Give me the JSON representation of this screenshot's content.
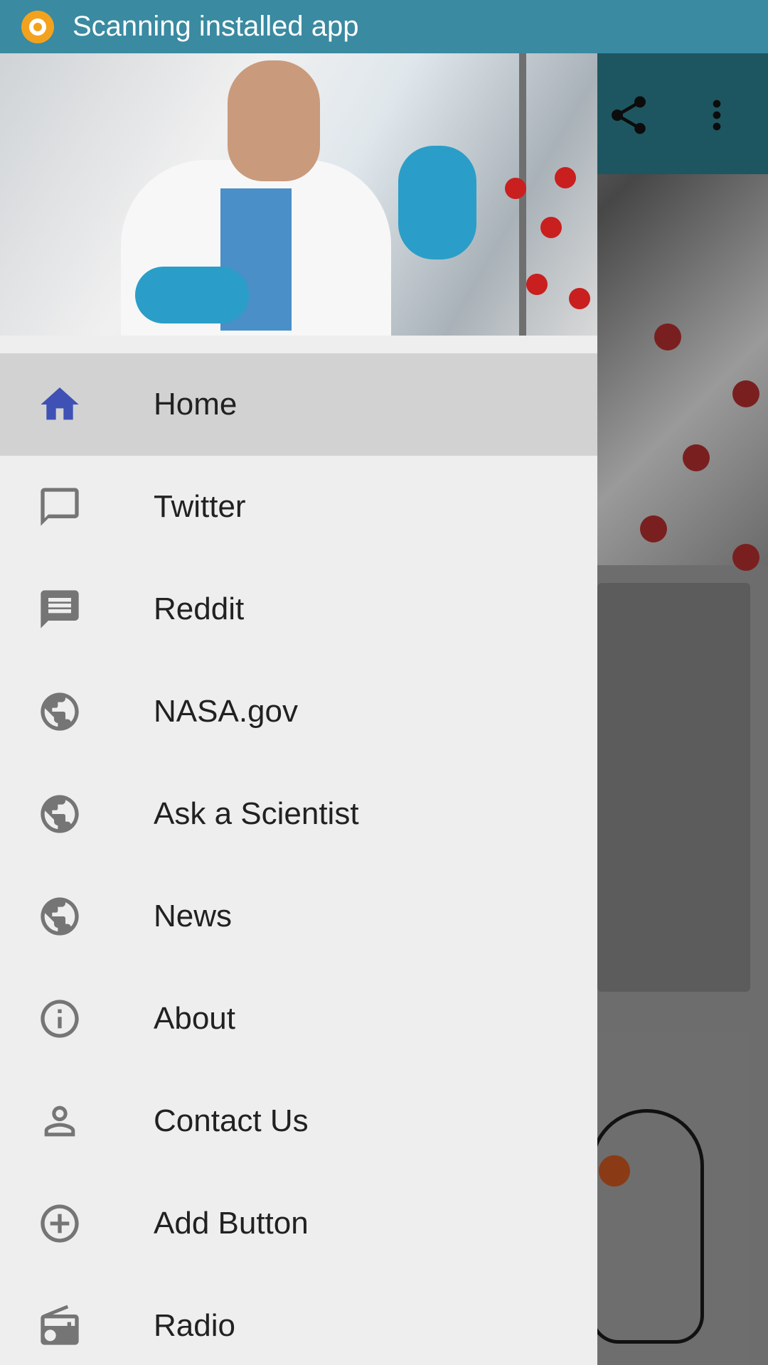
{
  "statusbar": {
    "text": "Scanning installed app"
  },
  "drawer": {
    "items": [
      {
        "label": "Home",
        "icon": "home-icon",
        "active": true
      },
      {
        "label": "Twitter",
        "icon": "chat-bubble-outline-icon"
      },
      {
        "label": "Reddit",
        "icon": "message-icon"
      },
      {
        "label": "NASA.gov",
        "icon": "globe-icon"
      },
      {
        "label": "Ask a Scientist",
        "icon": "globe-icon"
      },
      {
        "label": "News",
        "icon": "globe-icon"
      },
      {
        "label": "About",
        "icon": "info-icon"
      },
      {
        "label": "Contact Us",
        "icon": "person-icon"
      },
      {
        "label": "Add Button",
        "icon": "add-circle-icon"
      },
      {
        "label": "Radio",
        "icon": "radio-icon"
      }
    ]
  },
  "colors": {
    "accent": "#3f51b5",
    "statusbar": "#3a8aa1",
    "toolbar": "#1d5661",
    "icon_gray": "#757575"
  }
}
